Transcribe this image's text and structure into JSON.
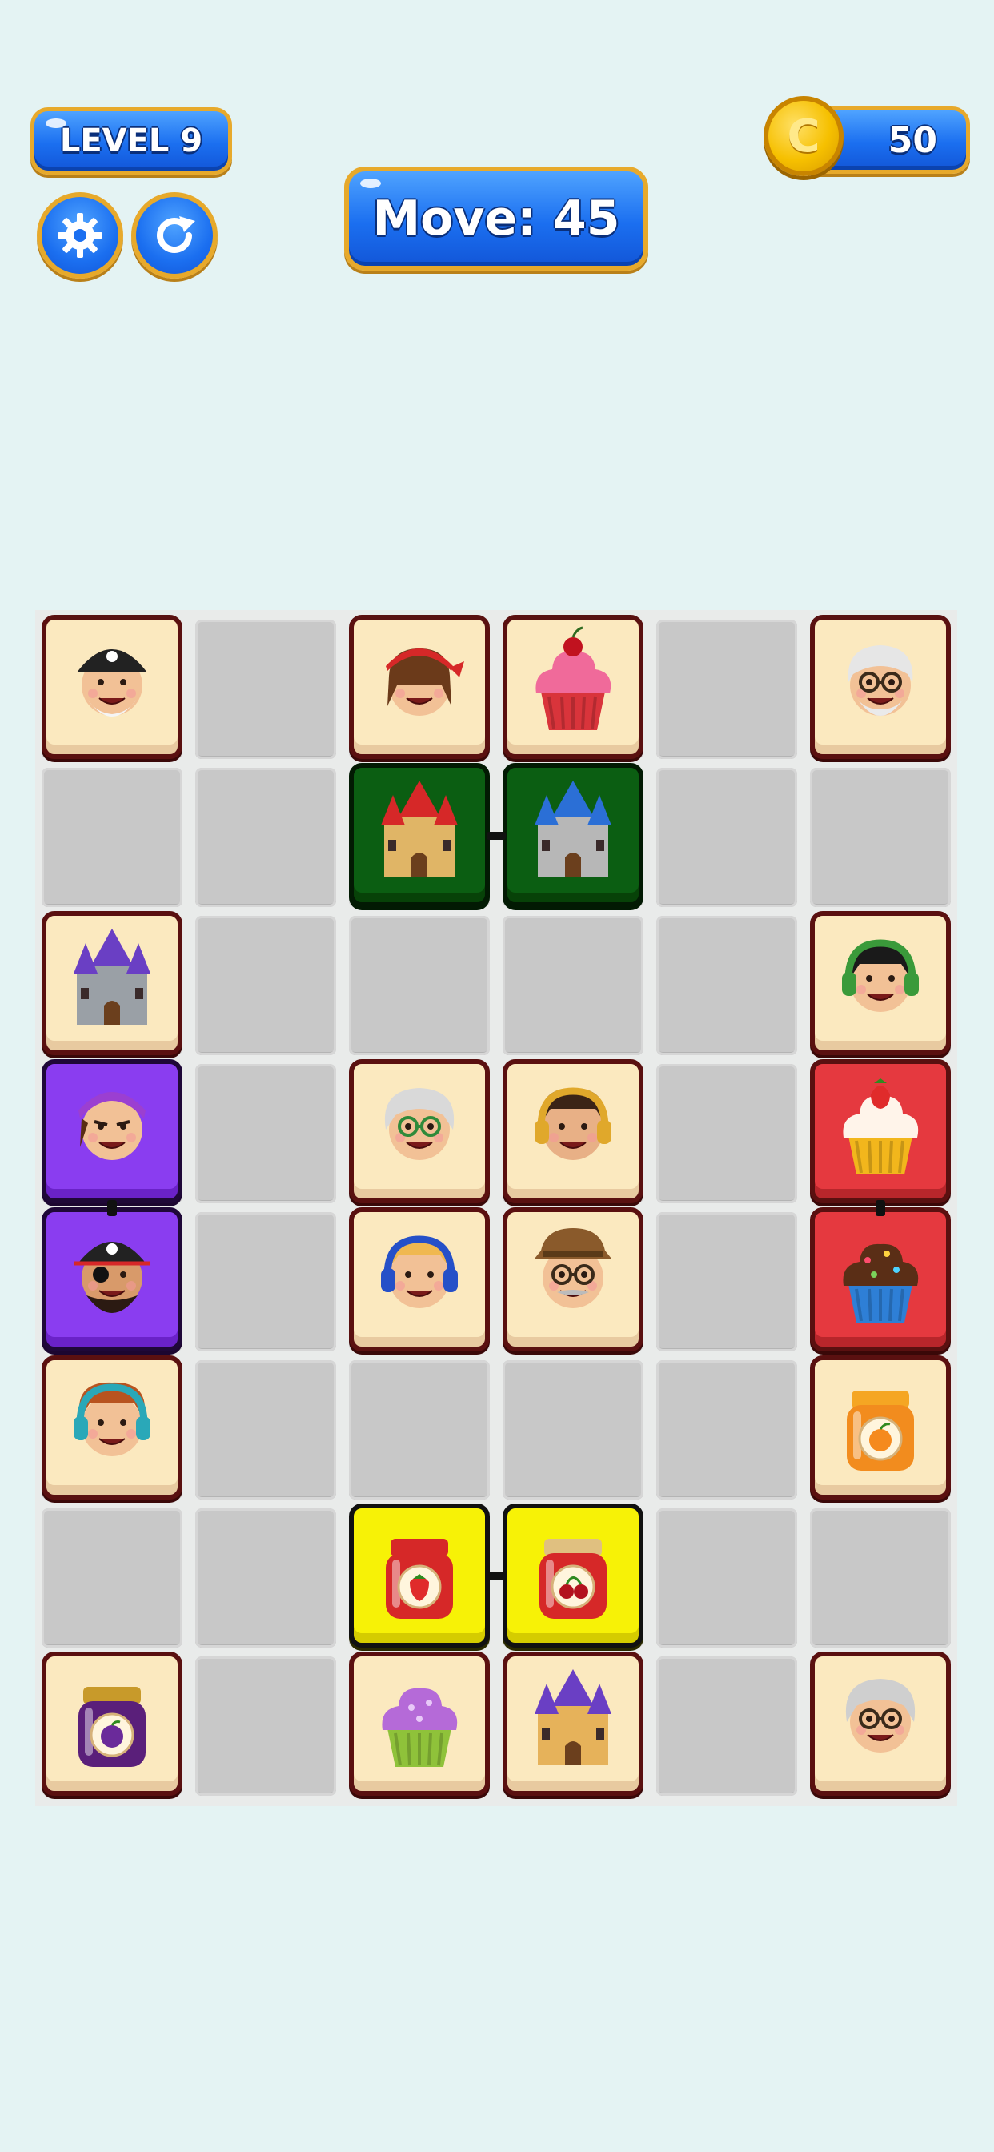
{
  "hud": {
    "level_label": "LEVEL 9",
    "moves_label": "Move: 45",
    "coins": "50",
    "coin_symbol": "C"
  },
  "colors": {
    "background": "#e4f3f3",
    "hud_blue": "#1b6ff0",
    "hud_border": "#e7a92b",
    "tile_cream": "#fbe9bf",
    "tile_border": "#5a1010",
    "linked_purple": "#8a3df0",
    "linked_red": "#e5393f",
    "linked_green": "#0b5e12",
    "linked_yellow": "#f7f206",
    "empty_cell": "#c8c8c8"
  },
  "board": {
    "columns": 6,
    "rows": 8,
    "tiles": [
      {
        "row": 0,
        "col": 0,
        "item": "pirate-captain",
        "icon": "pirate-smiling-icon",
        "style": "cream"
      },
      {
        "row": 0,
        "col": 2,
        "item": "girl-red-bandana",
        "icon": "girl-bandana-icon",
        "style": "cream"
      },
      {
        "row": 0,
        "col": 3,
        "item": "cherry-cupcake",
        "icon": "cherry-cupcake-icon",
        "style": "cream"
      },
      {
        "row": 0,
        "col": 5,
        "item": "grandpa-glasses",
        "icon": "grandpa-icon",
        "style": "cream"
      },
      {
        "row": 1,
        "col": 2,
        "item": "red-castle",
        "icon": "castle-red-roof-icon",
        "style": "green"
      },
      {
        "row": 1,
        "col": 3,
        "item": "blue-castle",
        "icon": "castle-blue-roof-icon",
        "style": "green"
      },
      {
        "row": 2,
        "col": 0,
        "item": "purple-castle",
        "icon": "castle-purple-roof-icon",
        "style": "cream"
      },
      {
        "row": 2,
        "col": 5,
        "item": "girl-green-headphones",
        "icon": "girl-headphones-icon",
        "style": "cream"
      },
      {
        "row": 3,
        "col": 0,
        "item": "angry-pirate-girl",
        "icon": "pirate-girl-icon",
        "style": "purple"
      },
      {
        "row": 3,
        "col": 2,
        "item": "grandma-green-glasses",
        "icon": "grandma-icon",
        "style": "cream"
      },
      {
        "row": 3,
        "col": 3,
        "item": "boy-yellow-headphones",
        "icon": "boy-headphones-icon",
        "style": "cream"
      },
      {
        "row": 3,
        "col": 5,
        "item": "strawberry-cupcake",
        "icon": "strawberry-cupcake-icon",
        "style": "red"
      },
      {
        "row": 4,
        "col": 0,
        "item": "eyepatch-pirate",
        "icon": "pirate-eyepatch-icon",
        "style": "purple"
      },
      {
        "row": 4,
        "col": 2,
        "item": "boy-blue-headphones",
        "icon": "boy-blue-headphones-icon",
        "style": "cream"
      },
      {
        "row": 4,
        "col": 3,
        "item": "grandpa-hat",
        "icon": "grandpa-hat-icon",
        "style": "cream"
      },
      {
        "row": 4,
        "col": 5,
        "item": "chocolate-cupcake",
        "icon": "chocolate-cupcake-icon",
        "style": "red"
      },
      {
        "row": 5,
        "col": 0,
        "item": "boy-teal-headphones",
        "icon": "boy-teal-headphones-icon",
        "style": "cream"
      },
      {
        "row": 5,
        "col": 5,
        "item": "orange-jam",
        "icon": "orange-jam-jar-icon",
        "style": "cream"
      },
      {
        "row": 6,
        "col": 2,
        "item": "strawberry-jam",
        "icon": "strawberry-jam-jar-icon",
        "style": "yellow"
      },
      {
        "row": 6,
        "col": 3,
        "item": "cherry-jam",
        "icon": "cherry-jam-jar-icon",
        "style": "yellow"
      },
      {
        "row": 7,
        "col": 0,
        "item": "plum-jam",
        "icon": "plum-jam-jar-icon",
        "style": "cream"
      },
      {
        "row": 7,
        "col": 2,
        "item": "purple-cupcake",
        "icon": "purple-cupcake-icon",
        "style": "cream"
      },
      {
        "row": 7,
        "col": 3,
        "item": "sand-castle",
        "icon": "sand-castle-icon",
        "style": "cream"
      },
      {
        "row": 7,
        "col": 5,
        "item": "grandma-glasses",
        "icon": "grandma-glasses-icon",
        "style": "cream"
      }
    ],
    "links": [
      {
        "from": [
          1,
          2
        ],
        "to": [
          1,
          3
        ],
        "direction": "horizontal"
      },
      {
        "from": [
          3,
          0
        ],
        "to": [
          4,
          0
        ],
        "direction": "vertical"
      },
      {
        "from": [
          3,
          5
        ],
        "to": [
          4,
          5
        ],
        "direction": "vertical"
      },
      {
        "from": [
          6,
          2
        ],
        "to": [
          6,
          3
        ],
        "direction": "horizontal"
      }
    ]
  }
}
